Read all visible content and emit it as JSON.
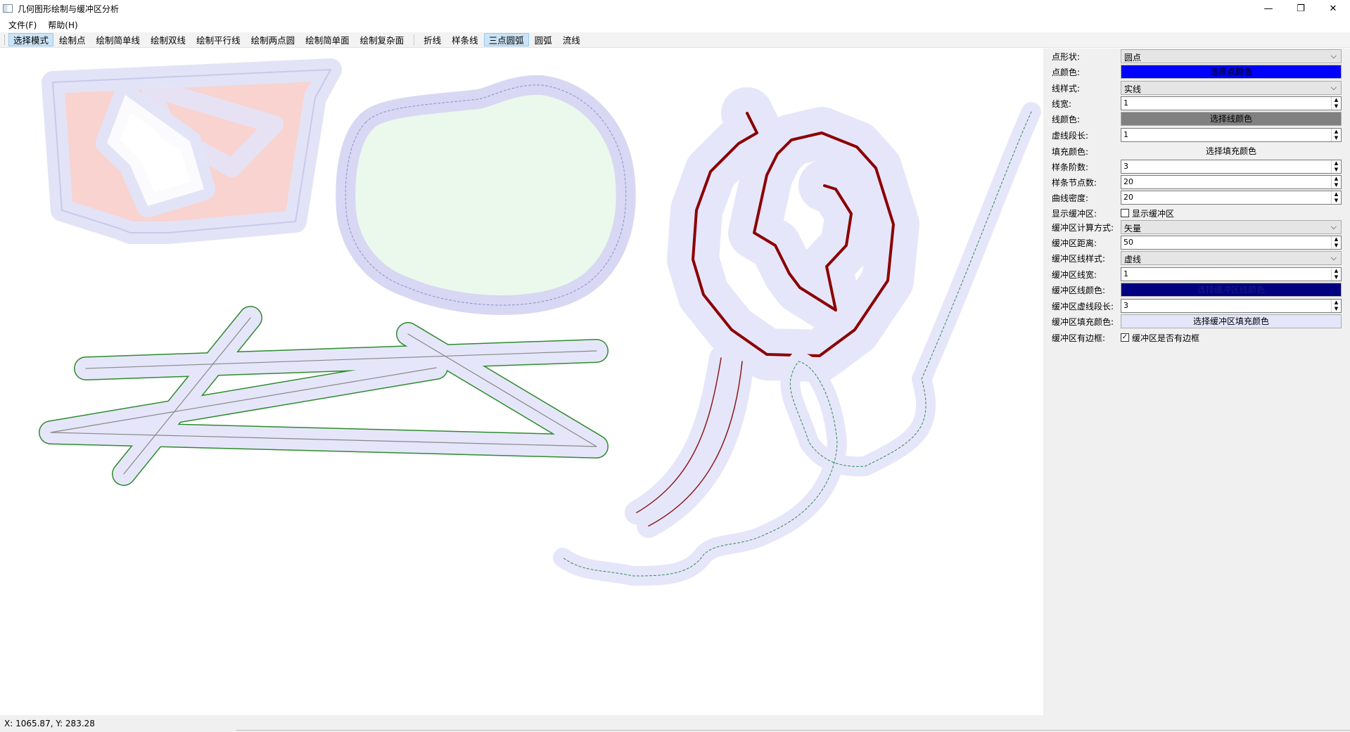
{
  "window": {
    "title": "几何图形绘制与缓冲区分析",
    "controls": {
      "minimize": "—",
      "maximize": "❐",
      "close": "✕"
    }
  },
  "menu": [
    "文件(F)",
    "帮助(H)"
  ],
  "toolbar": {
    "group1": [
      "选择模式",
      "绘制点",
      "绘制简单线",
      "绘制双线",
      "绘制平行线",
      "绘制两点圆",
      "绘制简单面",
      "绘制复杂面"
    ],
    "group2": [
      "折线",
      "样条线",
      "三点圆弧",
      "圆弧",
      "流线"
    ],
    "active": [
      "选择模式",
      "三点圆弧"
    ]
  },
  "properties": {
    "point_shape": {
      "label": "点形状:",
      "value": "圆点"
    },
    "point_color": {
      "label": "点颜色:",
      "button": "选择点颜色",
      "color": "#0000ff"
    },
    "line_style": {
      "label": "线样式:",
      "value": "实线"
    },
    "line_width": {
      "label": "线宽:",
      "value": "1"
    },
    "line_color": {
      "label": "线颜色:",
      "button": "选择线颜色",
      "color": "#808080"
    },
    "dash_length": {
      "label": "虚线段长:",
      "value": "1"
    },
    "fill_color": {
      "label": "填充颜色:",
      "button": "选择填充颜色"
    },
    "spline_order": {
      "label": "样条阶数:",
      "value": "3"
    },
    "spline_nodes": {
      "label": "样条节点数:",
      "value": "20"
    },
    "curve_density": {
      "label": "曲线密度:",
      "value": "20"
    },
    "show_buffer": {
      "label": "显示缓冲区:",
      "checkbox": "显示缓冲区",
      "checked": false
    },
    "buffer_method": {
      "label": "缓冲区计算方式:",
      "value": "矢量"
    },
    "buffer_distance": {
      "label": "缓冲区距离:",
      "value": "50"
    },
    "buffer_line_style": {
      "label": "缓冲区线样式:",
      "value": "虚线"
    },
    "buffer_line_width": {
      "label": "缓冲区线宽:",
      "value": "1"
    },
    "buffer_line_color": {
      "label": "缓冲区线颜色:",
      "button": "选择缓冲区线颜色",
      "color": "#000080"
    },
    "buffer_dash_length": {
      "label": "缓冲区虚线段长:",
      "value": "3"
    },
    "buffer_fill_color": {
      "label": "缓冲区填充颜色:",
      "button": "选择缓冲区填充颜色",
      "color": "#e6e6fa"
    },
    "buffer_border": {
      "label": "缓冲区有边框:",
      "checkbox": "缓冲区是否有边框",
      "checked": true
    }
  },
  "status": {
    "coords": "X: 1065.87, Y: 283.28"
  },
  "colors": {
    "buffer_fill": "#e6e6fa",
    "buffer_stroke": "#9a9ad0",
    "polygon_fill": "#f9d3cf",
    "circle_fill": "#ebf9ec",
    "spiral": "#8b0000",
    "green_outline": "#2e8b2e"
  }
}
